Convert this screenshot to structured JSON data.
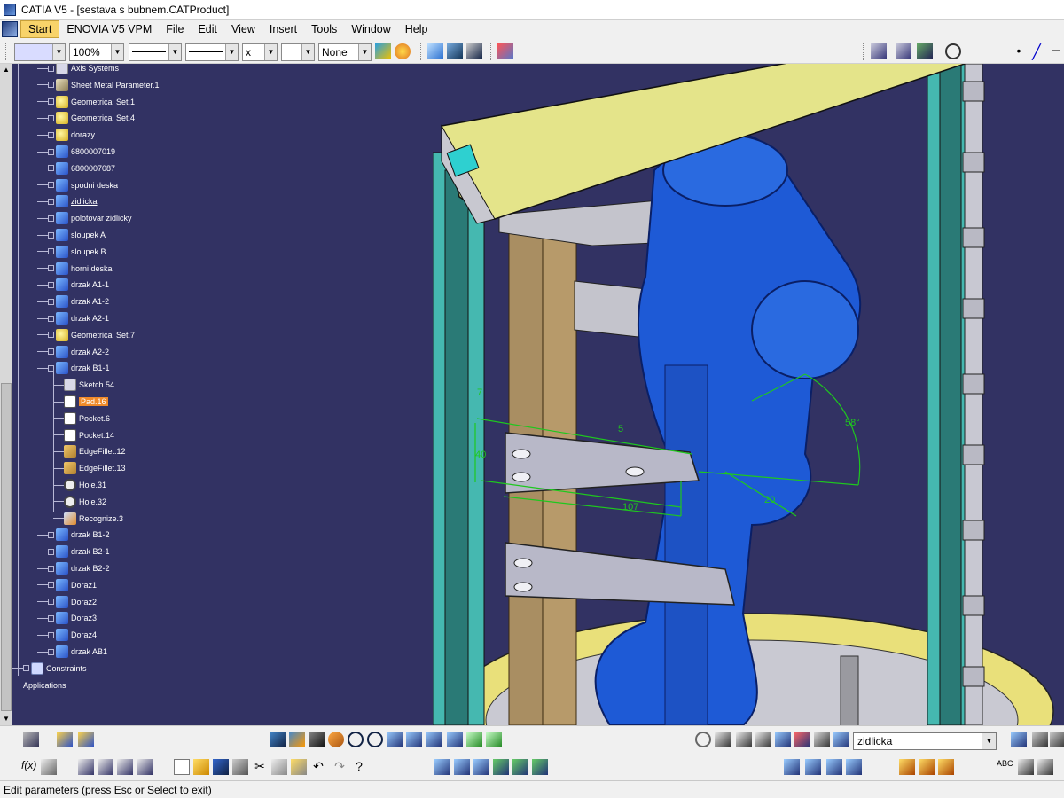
{
  "window": {
    "title": "CATIA V5 - [sestava s bubnem.CATProduct]"
  },
  "menu": {
    "items": [
      "Start",
      "ENOVIA V5 VPM",
      "File",
      "Edit",
      "View",
      "Insert",
      "Tools",
      "Window",
      "Help"
    ]
  },
  "toolbar": {
    "zoom_value": "100%",
    "linetype_value": "None",
    "thickness_value": "x"
  },
  "tree": {
    "items": [
      {
        "label": "Axis Systems",
        "icon": "axis-icon"
      },
      {
        "label": "Sheet Metal Parameter.1",
        "icon": "sheet-metal-icon"
      },
      {
        "label": "Geometrical Set.1",
        "icon": "geometrical-set-icon"
      },
      {
        "label": "Geometrical Set.4",
        "icon": "geometrical-set-icon"
      },
      {
        "label": "dorazy",
        "icon": "geometrical-set-icon"
      },
      {
        "label": "6800007019",
        "icon": "part-icon"
      },
      {
        "label": "6800007087",
        "icon": "part-icon"
      },
      {
        "label": "spodni deska",
        "icon": "part-icon"
      },
      {
        "label": "zidlicka",
        "icon": "part-icon"
      },
      {
        "label": "polotovar zidlicky",
        "icon": "part-icon"
      },
      {
        "label": "sloupek A",
        "icon": "part-icon"
      },
      {
        "label": "sloupek B",
        "icon": "part-icon"
      },
      {
        "label": "horni deska",
        "icon": "part-icon"
      },
      {
        "label": "drzak A1-1",
        "icon": "part-icon"
      },
      {
        "label": "drzak A1-2",
        "icon": "part-icon"
      },
      {
        "label": "drzak A2-1",
        "icon": "part-icon"
      },
      {
        "label": "Geometrical Set.7",
        "icon": "geometrical-set-icon"
      },
      {
        "label": "drzak A2-2",
        "icon": "part-icon"
      },
      {
        "label": "drzak B1-1",
        "icon": "part-icon"
      },
      {
        "label": "Sketch.54",
        "icon": "sketch-icon"
      },
      {
        "label": "Pad.16",
        "icon": "pad-icon"
      },
      {
        "label": "Pocket.6",
        "icon": "pocket-icon"
      },
      {
        "label": "Pocket.14",
        "icon": "pocket-icon"
      },
      {
        "label": "EdgeFillet.12",
        "icon": "edge-fillet-icon"
      },
      {
        "label": "EdgeFillet.13",
        "icon": "edge-fillet-icon"
      },
      {
        "label": "Hole.31",
        "icon": "hole-icon"
      },
      {
        "label": "Hole.32",
        "icon": "hole-icon"
      },
      {
        "label": "Recognize.3",
        "icon": "recognize-icon"
      },
      {
        "label": "drzak B1-2",
        "icon": "part-icon"
      },
      {
        "label": "drzak B2-1",
        "icon": "part-icon"
      },
      {
        "label": "drzak B2-2",
        "icon": "part-icon"
      },
      {
        "label": "Doraz1",
        "icon": "part-icon"
      },
      {
        "label": "Doraz2",
        "icon": "part-icon"
      },
      {
        "label": "Doraz3",
        "icon": "part-icon"
      },
      {
        "label": "Doraz4",
        "icon": "part-icon"
      },
      {
        "label": "drzak AB1",
        "icon": "part-icon"
      },
      {
        "label": "Constraints",
        "icon": "constraints-icon"
      },
      {
        "label": "Applications",
        "icon": "none"
      }
    ]
  },
  "viewport": {
    "dimensions": [
      "7",
      "40",
      "5",
      "107",
      "20",
      "58°"
    ]
  },
  "command_input": {
    "value": "zidlicka"
  },
  "status": {
    "message": "Edit parameters (press Esc or Select to exit)"
  }
}
